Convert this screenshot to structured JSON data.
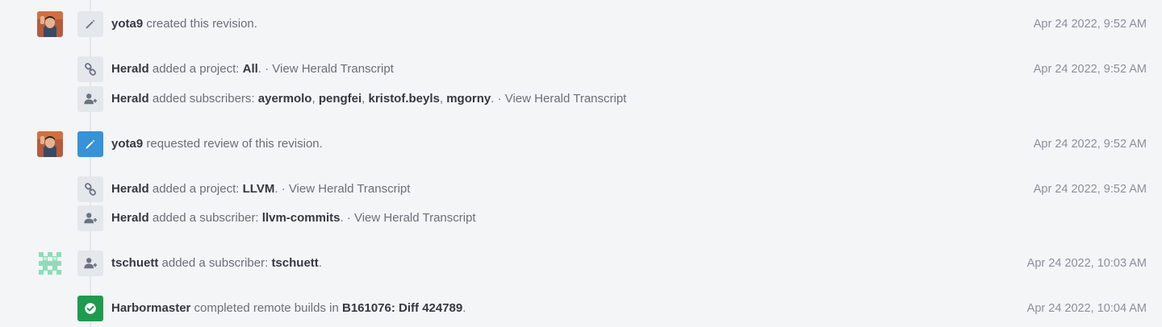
{
  "timeline": {
    "events": [
      {
        "actor": "yota9",
        "verb": " created this revision.",
        "date": "Apr 24 2022, 9:52 AM",
        "icon": "pencil-icon"
      },
      {
        "actor": "Herald",
        "verb": " added a project: ",
        "project": "All",
        "suffix": ". · ",
        "link": "View Herald Transcript",
        "date": "Apr 24 2022, 9:52 AM",
        "icon": "link-icon"
      },
      {
        "actor": "Herald",
        "verb": " added subscribers: ",
        "subscribers": [
          "ayermolo",
          "pengfei",
          "kristof.beyls",
          "mgorny"
        ],
        "sep": ", ",
        "suffix": ". · ",
        "link": "View Herald Transcript",
        "icon": "user-plus-icon"
      },
      {
        "actor": "yota9",
        "verb": " requested review of this revision.",
        "date": "Apr 24 2022, 9:52 AM",
        "icon": "pencil-icon"
      },
      {
        "actor": "Herald",
        "verb": " added a project: ",
        "project": "LLVM",
        "suffix": ". · ",
        "link": "View Herald Transcript",
        "date": "Apr 24 2022, 9:52 AM",
        "icon": "link-icon"
      },
      {
        "actor": "Herald",
        "verb": " added a subscriber: ",
        "subscriber": "llvm-commits",
        "suffix": ". · ",
        "link": "View Herald Transcript",
        "icon": "user-plus-icon"
      },
      {
        "actor": "tschuett",
        "verb": " added a subscriber: ",
        "subscriber": "tschuett",
        "suffix": ".",
        "date": "Apr 24 2022, 10:03 AM",
        "icon": "user-plus-icon"
      },
      {
        "actor": "Harbormaster",
        "verb": " completed remote builds in ",
        "build": "B161076: Diff 424789",
        "suffix": ".",
        "date": "Apr 24 2022, 10:04 AM",
        "icon": "check-circle-icon"
      }
    ]
  },
  "colors": {
    "background": "#f4f5f7",
    "icon_bg": "#e4e7ec",
    "accent_blue": "#3792d8",
    "success_green": "#1d9b4f"
  }
}
